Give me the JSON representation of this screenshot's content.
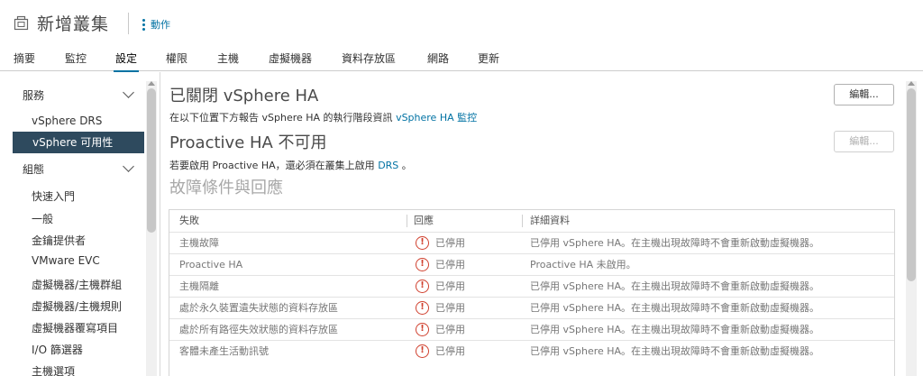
{
  "header": {
    "title": "新增叢集",
    "actions_label": "動作"
  },
  "tabs": [
    {
      "label": "摘要"
    },
    {
      "label": "監控"
    },
    {
      "label": "設定"
    },
    {
      "label": "權限"
    },
    {
      "label": "主機"
    },
    {
      "label": "虛擬機器"
    },
    {
      "label": "資料存放區"
    },
    {
      "label": "網路"
    },
    {
      "label": "更新"
    }
  ],
  "active_tab": "設定",
  "sidebar": {
    "section_services": "服務",
    "services_items": [
      "vSphere DRS",
      "vSphere 可用性"
    ],
    "section_config": "組態",
    "config_items": [
      "快速入門",
      "一般",
      "金鑰提供者",
      "VMware EVC",
      "虛擬機器/主機群組",
      "虛擬機器/主機規則",
      "虛擬機器覆寫項目",
      "I/O 篩選器",
      "主機選項"
    ],
    "selected": "vSphere 可用性"
  },
  "main": {
    "ha_title": "已關閉 vSphere HA",
    "ha_desc_prefix": "在以下位置下方報告 vSphere HA 的執行階段資訊",
    "ha_desc_link": "vSphere HA 監控",
    "edit_label": "編輯...",
    "proactive_title": "Proactive HA 不可用",
    "proactive_desc_prefix": "若要啟用 Proactive HA，還必須在叢集上啟用",
    "proactive_desc_link": "DRS",
    "proactive_desc_suffix": "。",
    "edit2_label": "編輯...",
    "failures_title": "故障條件與回應"
  },
  "table": {
    "headers": [
      "失敗",
      "回應",
      "詳細資料"
    ],
    "rows": [
      {
        "failure": "主機故障",
        "response": "已停用",
        "details": "已停用 vSphere HA。在主機出現故障時不會重新啟動虛擬機器。"
      },
      {
        "failure": "Proactive HA",
        "response": "已停用",
        "details": "Proactive HA 未啟用。"
      },
      {
        "failure": "主機隔離",
        "response": "已停用",
        "details": "已停用 vSphere HA。在主機出現故障時不會重新啟動虛擬機器。"
      },
      {
        "failure": "處於永久裝置遺失狀態的資料存放區",
        "response": "已停用",
        "details": "已停用 vSphere HA。在主機出現故障時不會重新啟動虛擬機器。"
      },
      {
        "failure": "處於所有路徑失效狀態的資料存放區",
        "response": "已停用",
        "details": "已停用 vSphere HA。在主機出現故障時不會重新啟動虛擬機器。"
      },
      {
        "failure": "客體未產生活動訊號",
        "response": "已停用",
        "details": "已停用 vSphere HA。在主機出現故障時不會重新啟動虛擬機器。"
      }
    ]
  },
  "colors": {
    "accent": "#0072a3",
    "selected_bg": "#2e4a5e",
    "alert": "#d0402e"
  }
}
